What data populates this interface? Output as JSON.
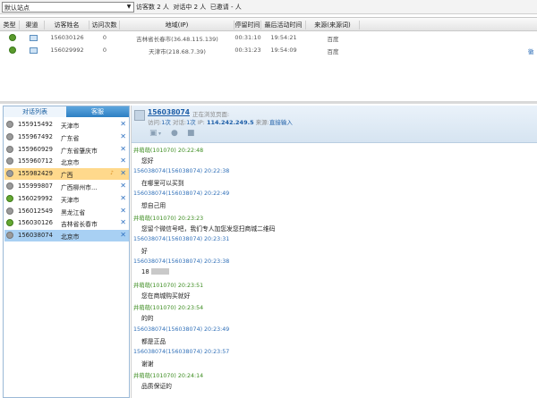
{
  "topbar": {
    "site_select": "默认站点",
    "visitors_label": "访客数 2 人",
    "chatting_label": "对话中 2 人",
    "invited_label": "已邀请 - 人"
  },
  "visitor_table": {
    "columns": [
      "类型",
      "渠道",
      "访客姓名",
      "访问次数",
      "地域(IP)",
      "停留时间",
      "最后活动时间",
      "来源(来源词)"
    ],
    "rows": [
      {
        "name": "156030126",
        "visits": "0",
        "region": "吉林省长春市(36.48.115.139)",
        "stay": "00:31:10",
        "last": "19:54:21",
        "source": "百度"
      },
      {
        "name": "156029992",
        "visits": "0",
        "region": "天津市(218.68.7.39)",
        "stay": "00:31:23",
        "last": "19:54:09",
        "source": "百度"
      }
    ],
    "right_edge_text": "徽"
  },
  "left_panel": {
    "tabs": [
      "对话列表",
      "客服"
    ],
    "conversations": [
      {
        "id": "155915492",
        "loc": "天津市",
        "dot": "gray"
      },
      {
        "id": "155967492",
        "loc": "广东省",
        "dot": "gray"
      },
      {
        "id": "155960929",
        "loc": "广东省肇庆市",
        "dot": "gray"
      },
      {
        "id": "155960712",
        "loc": "北京市",
        "dot": "gray"
      },
      {
        "id": "155982429",
        "loc": "广西",
        "dot": "gray",
        "state": "alert"
      },
      {
        "id": "155999807",
        "loc": "广西柳州市...",
        "dot": "gray"
      },
      {
        "id": "156029992",
        "loc": "天津市",
        "dot": "green"
      },
      {
        "id": "156012549",
        "loc": "黑龙江省",
        "dot": "gray"
      },
      {
        "id": "156030126",
        "loc": "吉林省长春市",
        "dot": "green"
      },
      {
        "id": "156038074",
        "loc": "北京市",
        "dot": "gray",
        "state": "selected"
      }
    ]
  },
  "visitor_header": {
    "id": "156038074",
    "page": "正在浏览页面:",
    "visits_label": "访问:",
    "visits_value": "1次",
    "chats_label": "对话:",
    "chats_value": "1次",
    "ip_label": "IP:",
    "ip_value": "114.242.249.5",
    "source_label": "来源:",
    "source_value": "直接输入"
  },
  "messages": [
    {
      "who": "agent",
      "meta": "井萌萌(101070)  20:22:48",
      "text": "您好"
    },
    {
      "who": "user",
      "meta": "156038074(156038074)  20:22:38",
      "text": "在哪里可以买到"
    },
    {
      "who": "user",
      "meta": "156038074(156038074)  20:22:49",
      "text": "想自己用"
    },
    {
      "who": "agent",
      "meta": "井萌萌(101070)  20:23:23",
      "text": "您留个微信号吧，我们专人加您发您扫商城二维码"
    },
    {
      "who": "user",
      "meta": "156038074(156038074)  20:23:31",
      "text": "好"
    },
    {
      "who": "user",
      "meta": "156038074(156038074)  20:23:38",
      "text": "18"
    },
    {
      "who": "agent",
      "meta": "井萌萌(101070)  20:23:51",
      "text": "您在商城购买就好"
    },
    {
      "who": "agent",
      "meta": "井萌萌(101070)  20:23:54",
      "text": "的的"
    },
    {
      "who": "user",
      "meta": "156038074(156038074)  20:23:49",
      "text": "都是正品"
    },
    {
      "who": "user",
      "meta": "156038074(156038074)  20:23:57",
      "text": "谢谢"
    },
    {
      "who": "agent",
      "meta": "井萌萌(101070)  20:24:14",
      "text": "品质保证的"
    }
  ]
}
